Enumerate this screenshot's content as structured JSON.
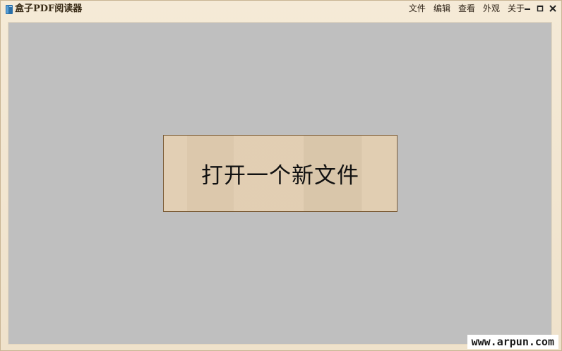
{
  "window": {
    "title": "盒子PDF阅读器",
    "app_icon": "book-icon"
  },
  "menu": {
    "items": [
      "文件",
      "编辑",
      "查看",
      "外观",
      "关于"
    ]
  },
  "window_controls": {
    "minimize_icon": "minimize-icon",
    "maximize_icon": "maximize-icon",
    "close_icon": "close-icon"
  },
  "main": {
    "open_button_label": "打开一个新文件"
  },
  "watermark": {
    "text": "www.arpun.com"
  },
  "colors": {
    "frame": "#f1e6d2",
    "content_bg": "#bfbfbf",
    "button_bg": "#e0ccaf",
    "button_border": "#7b5c37",
    "icon_blue": "#2a6fa8"
  }
}
